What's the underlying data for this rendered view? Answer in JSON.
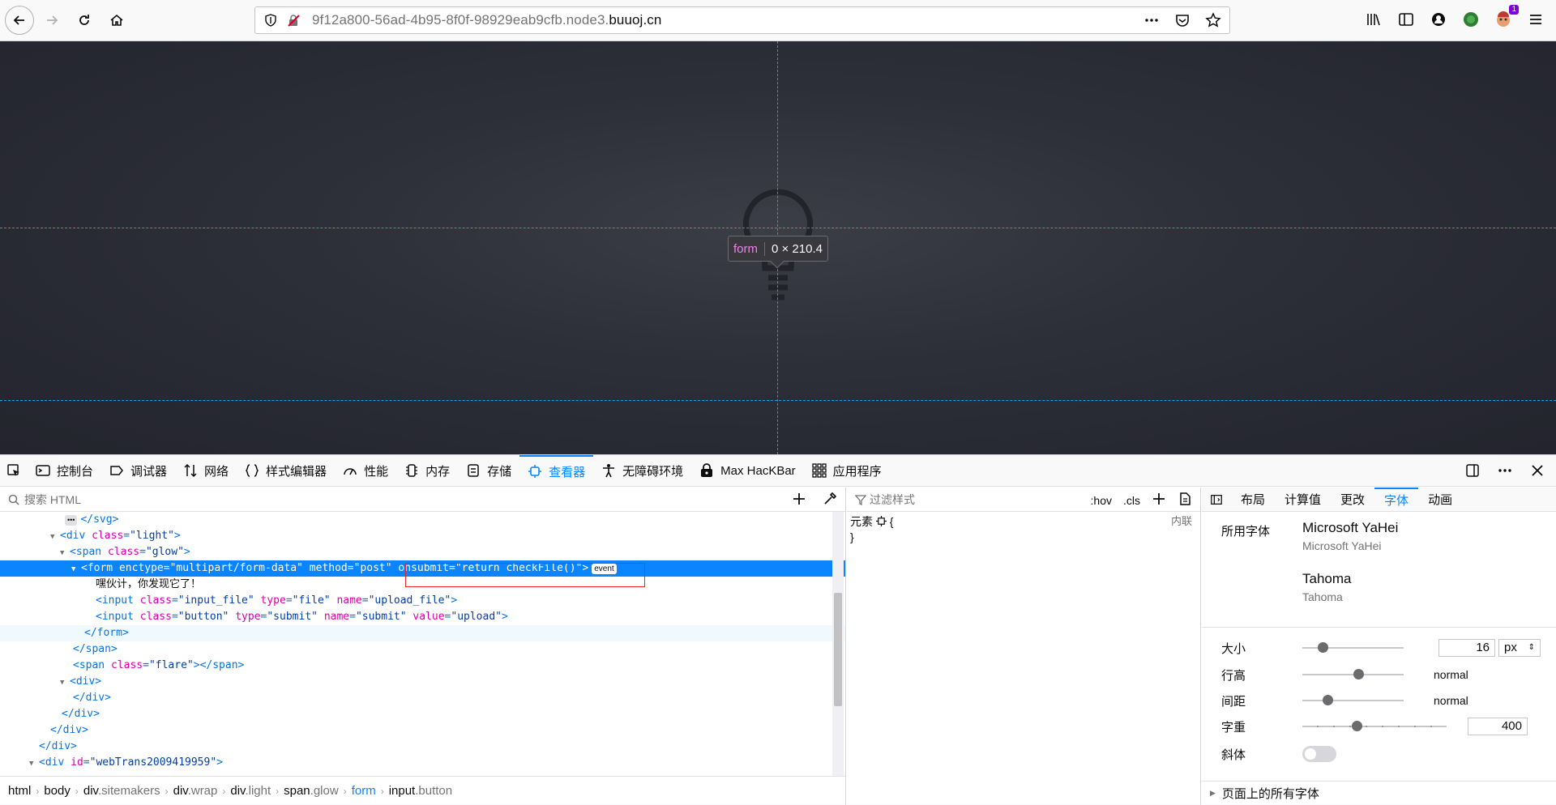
{
  "browser": {
    "url_prefix": "9f12a800-56ad-4b95-8f0f-98929eab9cfb.node3.",
    "url_domain": "buuoj.cn",
    "addon_badge": "1"
  },
  "viewport": {
    "infobar_tag": "form",
    "infobar_dims": "0 × 210.4"
  },
  "devtools": {
    "tabs": [
      {
        "label": "控制台",
        "icon": "console-icon"
      },
      {
        "label": "调试器",
        "icon": "debugger-icon"
      },
      {
        "label": "网络",
        "icon": "network-icon"
      },
      {
        "label": "样式编辑器",
        "icon": "style-editor-icon"
      },
      {
        "label": "性能",
        "icon": "performance-icon"
      },
      {
        "label": "内存",
        "icon": "memory-icon"
      },
      {
        "label": "存储",
        "icon": "storage-icon"
      },
      {
        "label": "查看器",
        "icon": "inspector-icon"
      },
      {
        "label": "无障碍环境",
        "icon": "accessibility-icon"
      },
      {
        "label": "Max HacKBar",
        "icon": "hackbar-icon"
      },
      {
        "label": "应用程序",
        "icon": "application-icon"
      }
    ],
    "active_tab": "查看器",
    "search_placeholder": "搜索 HTML",
    "tree": {
      "l0_close": "</svg>",
      "l1_tag": "<div",
      "l1_attr": "class",
      "l1_val": "\"light\"",
      "l2_tag": "<span",
      "l2_attr": "class",
      "l2_val": "\"glow\"",
      "l3_tag": "<form",
      "l3_a1": "enctype",
      "l3_v1": "\"multipart/form-data\"",
      "l3_a2": "method",
      "l3_v2": "\"post\"",
      "l3_a3": "onsubmit",
      "l3_v3": "\"return checkFile()\"",
      "l3_badge": "event",
      "l4_text": "嘿伙计，你发现它了！",
      "l5_tag": "<input",
      "l5_a1": "class",
      "l5_v1": "\"input_file\"",
      "l5_a2": "type",
      "l5_v2": "\"file\"",
      "l5_a3": "name",
      "l5_v3": "\"upload_file\"",
      "l6_tag": "<input",
      "l6_a1": "class",
      "l6_v1": "\"button\"",
      "l6_a2": "type",
      "l6_v2": "\"submit\"",
      "l6_a3": "name",
      "l6_v3": "\"submit\"",
      "l6_a4": "value",
      "l6_v4": "\"upload\"",
      "l7_close": "</form>",
      "l8_close": "</span>",
      "l9_tag": "<span",
      "l9_attr": "class",
      "l9_val": "\"flare\"",
      "l9_close": "</span>",
      "l10_tag": "<div>",
      "l11_close": "</div>",
      "l12_close": "</div>",
      "l13_close": "</div>",
      "l14_close": "</div>",
      "l15_tag": "<div",
      "l15_attr": "id",
      "l15_val": "\"webTrans2009419959\""
    },
    "breadcrumbs": [
      {
        "tag": "html",
        "cls": ""
      },
      {
        "tag": "body",
        "cls": ""
      },
      {
        "tag": "div",
        "cls": ".sitemakers"
      },
      {
        "tag": "div",
        "cls": ".wrap"
      },
      {
        "tag": "div",
        "cls": ".light"
      },
      {
        "tag": "span",
        "cls": ".glow"
      },
      {
        "tag": "form",
        "cls": ""
      },
      {
        "tag": "input",
        "cls": ".button"
      }
    ],
    "rules": {
      "filter_placeholder": "过滤样式",
      "hov": ":hov",
      "cls": ".cls",
      "element_label": "元素",
      "open_brace": "{",
      "close_brace": "}",
      "inline_source": "内联"
    },
    "fonts_panel": {
      "tabs": [
        "布局",
        "计算值",
        "更改",
        "字体",
        "动画"
      ],
      "active_tab": "字体",
      "used_fonts_label": "所用字体",
      "fonts": [
        {
          "name": "Microsoft YaHei",
          "source": "Microsoft YaHei"
        },
        {
          "name": "Tahoma",
          "source": "Tahoma"
        }
      ],
      "size_label": "大小",
      "size_value": "16",
      "size_unit": "px",
      "size_slider_level": 0.2,
      "line_height_label": "行高",
      "line_height_value": "normal",
      "line_height_slider_level": 0.55,
      "spacing_label": "间距",
      "spacing_value": "normal",
      "spacing_slider_level": 0.25,
      "weight_label": "字重",
      "weight_value": "400",
      "weight_slider_level": 0.375,
      "italic_label": "斜体",
      "italic_on": false,
      "all_fonts_label": "页面上的所有字体"
    }
  }
}
